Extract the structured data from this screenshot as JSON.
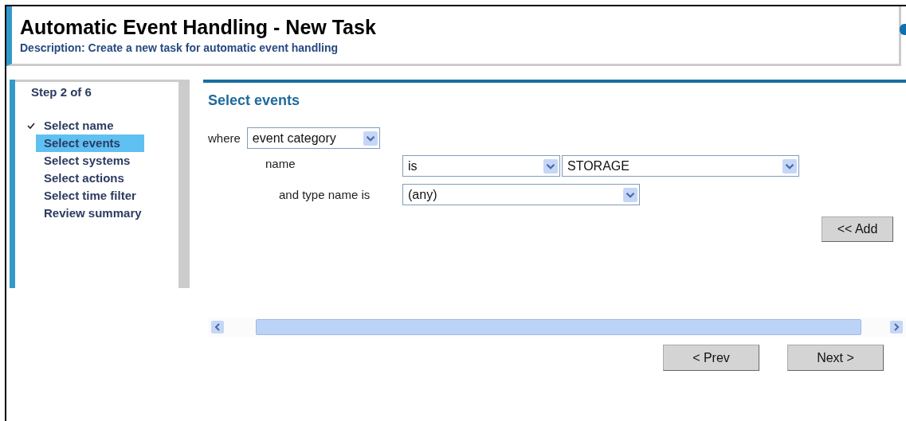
{
  "header": {
    "title": "Automatic Event Handling - New Task",
    "description": "Description: Create a new task for automatic event handling"
  },
  "sidebar": {
    "step": "Step  2  of 6",
    "steps": [
      {
        "label": "Select name",
        "checked": true,
        "selected": false
      },
      {
        "label": "Select events",
        "checked": false,
        "selected": true
      },
      {
        "label": "Select systems",
        "checked": false,
        "selected": false
      },
      {
        "label": "Select actions",
        "checked": false,
        "selected": false
      },
      {
        "label": "Select time filter",
        "checked": false,
        "selected": false
      },
      {
        "label": "Review summary",
        "checked": false,
        "selected": false
      }
    ]
  },
  "panel": {
    "title": "Select events",
    "where": {
      "label": "where",
      "value": "event category"
    },
    "name": {
      "label": "name",
      "operator": "is",
      "value": "STORAGE"
    },
    "type": {
      "label": "and type name is",
      "value": "(any)"
    },
    "add_button": "<< Add",
    "buttons": [
      "< Prev",
      "Next >"
    ]
  }
}
